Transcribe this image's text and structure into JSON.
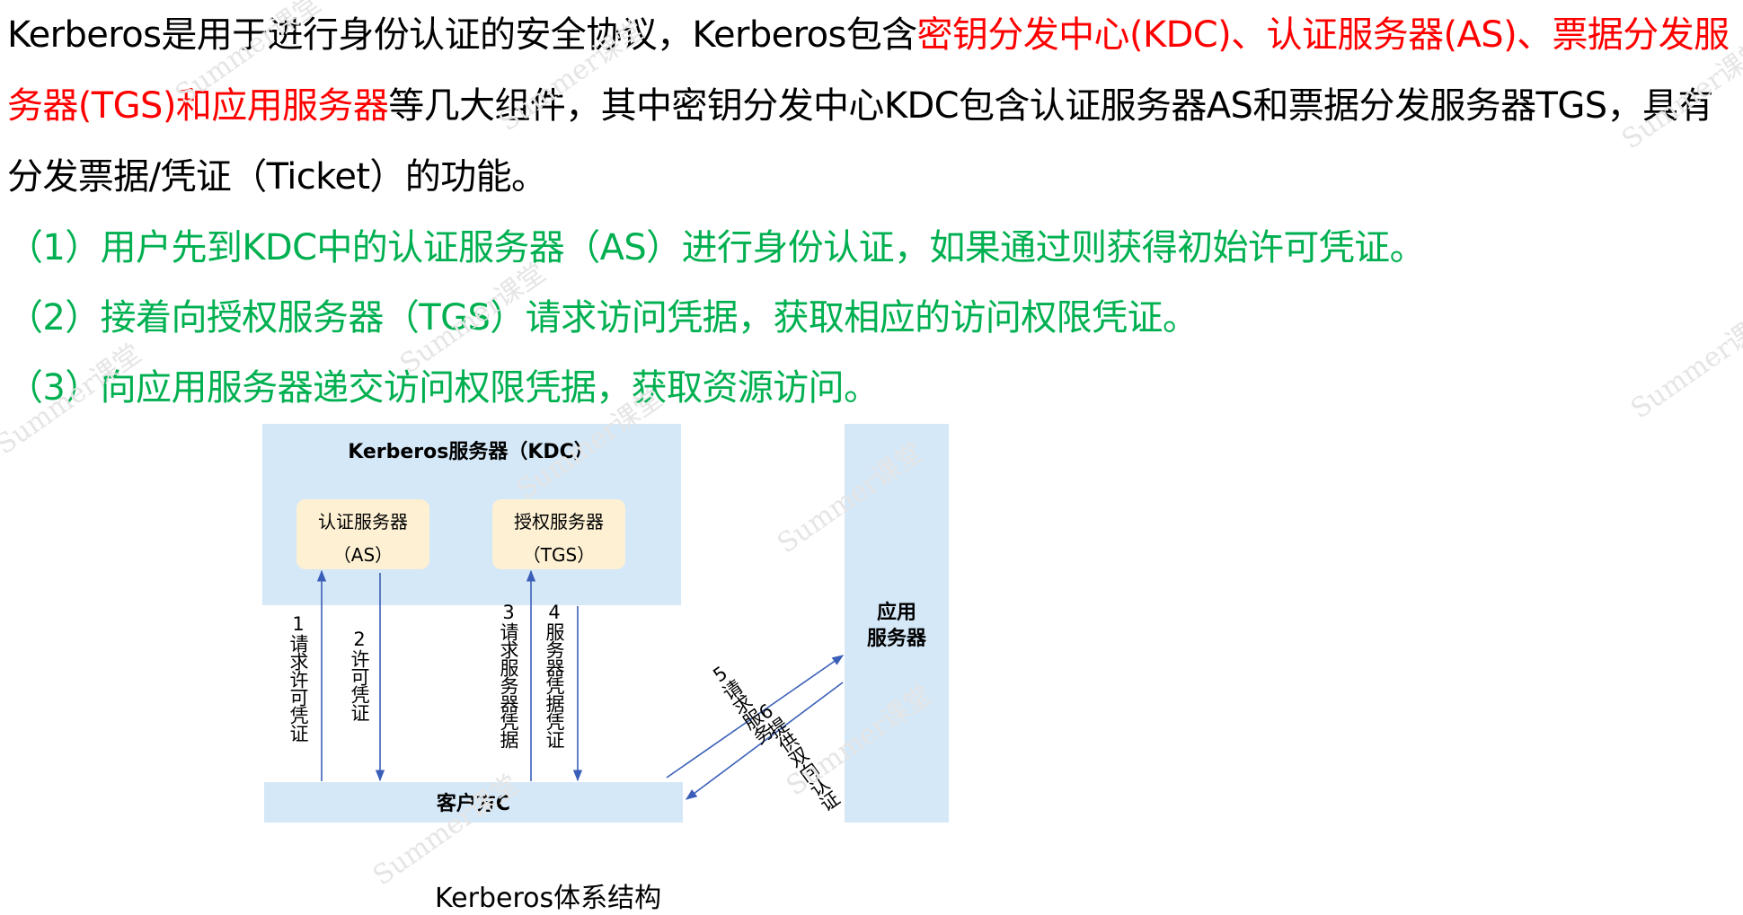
{
  "intro": {
    "p1": "Kerberos是用于进行身份认证的安全协议，Kerberos包含",
    "p2_red": "密钥分发中心(KDC)、认证服务器(AS)、票据分发服务器(TGS)和应用服务器",
    "p3": "等几大组件，其中密钥分发中心KDC包含认证服务器AS和票据分发服务器TGS，具有分发票据/凭证（Ticket）的功能。"
  },
  "steps": [
    "（1）用户先到KDC中的认证服务器（AS）进行身份认证，如果通过则获得初始许可凭证。",
    "（2）接着向授权服务器（TGS）请求访问凭据，获取相应的访问权限凭证。",
    "（3）向应用服务器递交访问权限凭据，获取资源访问。"
  ],
  "diagram": {
    "kdc_title": "Kerberos服务器（KDC）",
    "as_name": "认证服务器",
    "as_abbr": "（AS）",
    "tgs_name": "授权服务器",
    "tgs_abbr": "（TGS）",
    "app_line1": "应用",
    "app_line2": "服务器",
    "client": "客户方C",
    "arrow1": "1请求许可凭证",
    "arrow2": "2许可凭证",
    "arrow3": "3请求服务器凭据",
    "arrow4": "4服务器凭据凭证",
    "arrow5": "5请求服务",
    "arrow6": "6提供双向认证"
  },
  "caption": "Kerberos体系结构",
  "watermark": "Summer课堂",
  "colors": {
    "red": "#ff0000",
    "green": "#00b050",
    "box_blue": "#d5e8f8",
    "box_cream": "#fdf0d3",
    "arrow": "#3b5fb8"
  }
}
